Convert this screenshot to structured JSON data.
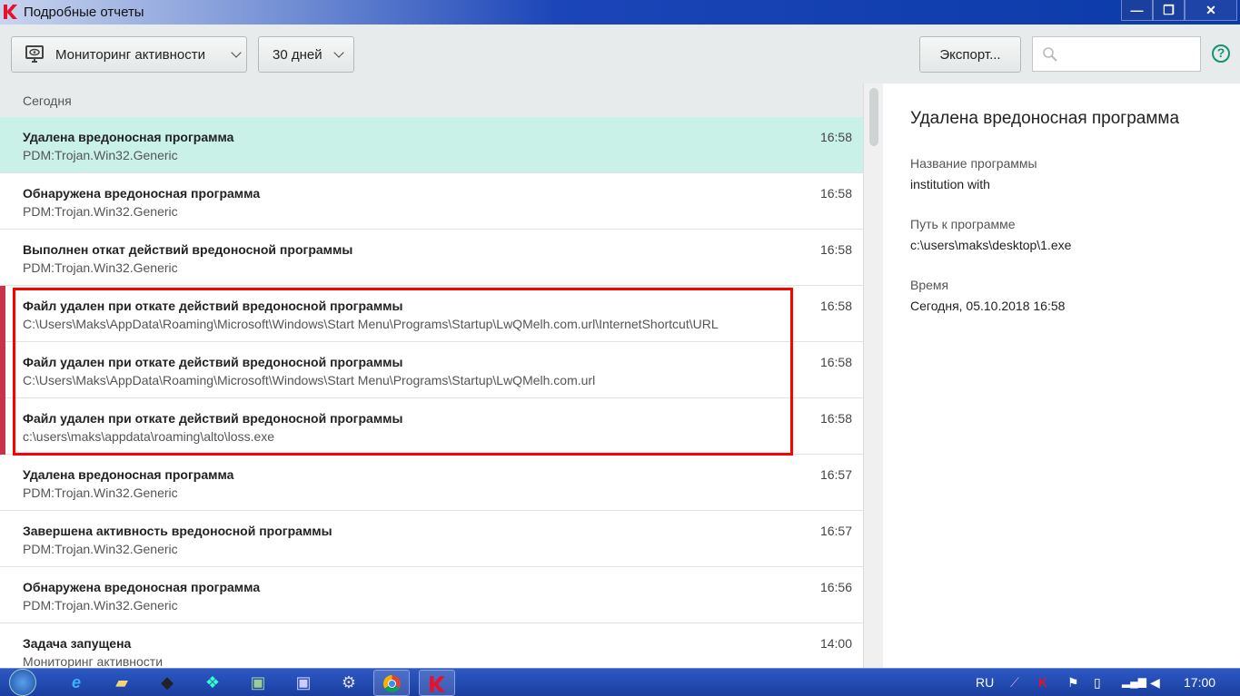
{
  "window": {
    "title": "Подробные отчеты",
    "minimize": "—",
    "restore": "❐",
    "close": "✕"
  },
  "toolbar": {
    "report_type": "Мониторинг активности",
    "period": "30 дней",
    "export": "Экспорт...",
    "search_placeholder": "",
    "help": "?"
  },
  "list": {
    "section": "Сегодня",
    "rows": [
      {
        "title": "Удалена вредоносная программа",
        "sub": "PDM:Trojan.Win32.Generic",
        "time": "16:58"
      },
      {
        "title": "Обнаружена вредоносная программа",
        "sub": "PDM:Trojan.Win32.Generic",
        "time": "16:58"
      },
      {
        "title": "Выполнен откат действий вредоносной программы",
        "sub": "PDM:Trojan.Win32.Generic",
        "time": "16:58"
      },
      {
        "title": "Файл удален при откате действий вредоносной программы",
        "sub": "C:\\Users\\Maks\\AppData\\Roaming\\Microsoft\\Windows\\Start Menu\\Programs\\Startup\\LwQMelh.com.url\\InternetShortcut\\URL",
        "time": "16:58"
      },
      {
        "title": "Файл удален при откате действий вредоносной программы",
        "sub": "C:\\Users\\Maks\\AppData\\Roaming\\Microsoft\\Windows\\Start Menu\\Programs\\Startup\\LwQMelh.com.url",
        "time": "16:58"
      },
      {
        "title": "Файл удален при откате действий вредоносной программы",
        "sub": "c:\\users\\maks\\appdata\\roaming\\alto\\loss.exe",
        "time": "16:58"
      },
      {
        "title": "Удалена вредоносная программа",
        "sub": "PDM:Trojan.Win32.Generic",
        "time": "16:57"
      },
      {
        "title": "Завершена активность вредоносной программы",
        "sub": "PDM:Trojan.Win32.Generic",
        "time": "16:57"
      },
      {
        "title": "Обнаружена вредоносная программа",
        "sub": "PDM:Trojan.Win32.Generic",
        "time": "16:56"
      },
      {
        "title": "Задача запущена",
        "sub": "Мониторинг активности",
        "time": "14:00"
      }
    ]
  },
  "detail": {
    "title": "Удалена вредоносная программа",
    "name_label": "Название программы",
    "name_value": "institution with",
    "path_label": "Путь к программе",
    "path_value": "c:\\users\\maks\\desktop\\1.exe",
    "time_label": "Время",
    "time_value": "Сегодня, 05.10.2018 16:58"
  },
  "taskbar": {
    "lang": "RU",
    "clock": "17:00"
  },
  "colors": {
    "selected": "#c9f1e7",
    "highlight": "#ff0000",
    "accent": "#13946f"
  }
}
